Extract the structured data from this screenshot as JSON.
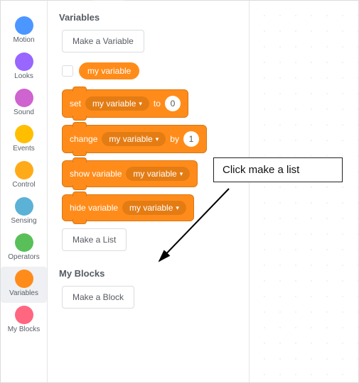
{
  "categories": [
    {
      "name": "Motion",
      "color": "#4c97ff",
      "selected": false
    },
    {
      "name": "Looks",
      "color": "#9966ff",
      "selected": false
    },
    {
      "name": "Sound",
      "color": "#cf63cf",
      "selected": false
    },
    {
      "name": "Events",
      "color": "#ffbf00",
      "selected": false
    },
    {
      "name": "Control",
      "color": "#ffab19",
      "selected": false
    },
    {
      "name": "Sensing",
      "color": "#5cb1d6",
      "selected": false
    },
    {
      "name": "Operators",
      "color": "#59c059",
      "selected": false
    },
    {
      "name": "Variables",
      "color": "#ff8c1a",
      "selected": true
    },
    {
      "name": "My Blocks",
      "color": "#ff6680",
      "selected": false
    }
  ],
  "palette": {
    "variables_title": "Variables",
    "make_variable_label": "Make a Variable",
    "variable_pill": "my variable",
    "set_block": {
      "prefix": "set",
      "var": "my variable",
      "mid": "to",
      "value": "0"
    },
    "change_block": {
      "prefix": "change",
      "var": "my variable",
      "mid": "by",
      "value": "1"
    },
    "show_block": {
      "prefix": "show variable",
      "var": "my variable"
    },
    "hide_block": {
      "prefix": "hide variable",
      "var": "my variable"
    },
    "make_list_label": "Make a List",
    "myblocks_title": "My Blocks",
    "make_block_label": "Make a Block"
  },
  "annotation": {
    "text": "Click make a list"
  }
}
